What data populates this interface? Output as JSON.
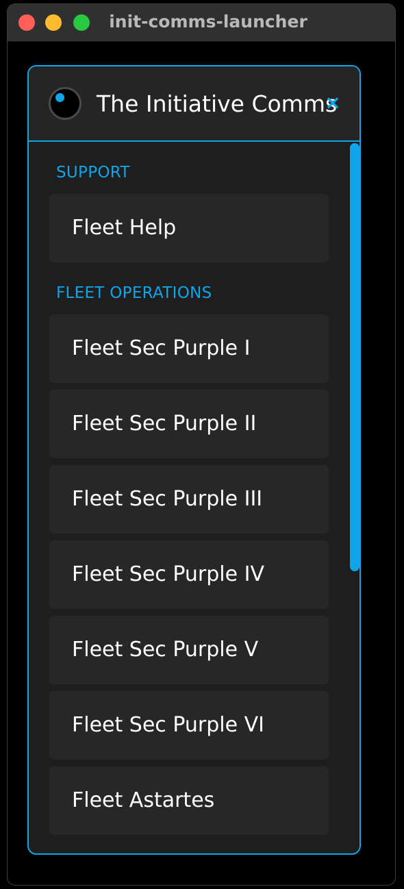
{
  "window": {
    "title": "init-comms-launcher"
  },
  "panel": {
    "title": "The Initiative Comms",
    "close_icon": "×"
  },
  "sections": [
    {
      "label": "SUPPORT",
      "items": [
        {
          "label": "Fleet Help"
        }
      ]
    },
    {
      "label": "FLEET OPERATIONS",
      "items": [
        {
          "label": "Fleet Sec Purple I"
        },
        {
          "label": "Fleet Sec Purple II"
        },
        {
          "label": "Fleet Sec Purple III"
        },
        {
          "label": "Fleet Sec Purple IV"
        },
        {
          "label": "Fleet Sec Purple V"
        },
        {
          "label": "Fleet Sec Purple VI"
        },
        {
          "label": "Fleet Astartes"
        }
      ]
    }
  ],
  "colors": {
    "accent": "#0ea5e9",
    "panel_background": "#1e1e1e",
    "item_background": "#272727",
    "text": "#ffffff"
  },
  "icons": {
    "logo": "logo-icon",
    "close": "close-icon"
  }
}
